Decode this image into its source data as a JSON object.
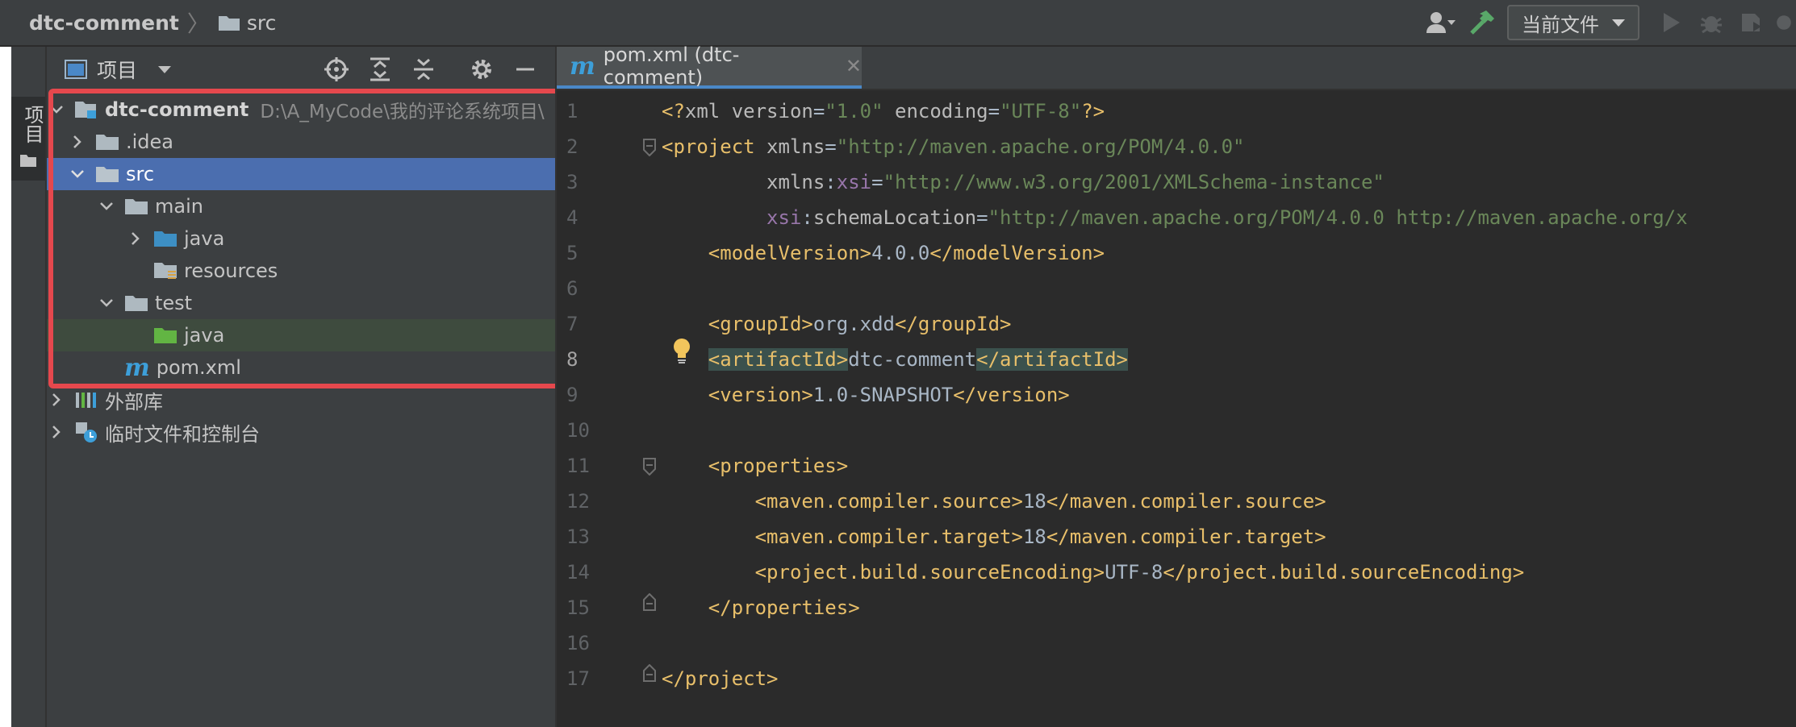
{
  "breadcrumb": {
    "root": "dtc-comment",
    "folder": "src"
  },
  "toolbar": {
    "run_config": "当前文件"
  },
  "tool_strip": {
    "project_tab": "项目"
  },
  "project_panel": {
    "title": "项目",
    "tree": [
      {
        "label": "dtc-comment",
        "path": "D:\\A_MyCode\\我的评论系统项目\\",
        "depth": 0,
        "expanded": true,
        "icon": "module-folder-icon"
      },
      {
        "label": ".idea",
        "depth": 1,
        "expanded": false,
        "icon": "folder-icon"
      },
      {
        "label": "src",
        "depth": 1,
        "expanded": true,
        "icon": "folder-icon",
        "selected": true
      },
      {
        "label": "main",
        "depth": 2,
        "expanded": true,
        "icon": "folder-icon"
      },
      {
        "label": "java",
        "depth": 3,
        "expanded": false,
        "icon": "source-folder-icon"
      },
      {
        "label": "resources",
        "depth": 3,
        "icon": "resources-folder-icon"
      },
      {
        "label": "test",
        "depth": 2,
        "expanded": true,
        "icon": "folder-icon"
      },
      {
        "label": "java",
        "depth": 3,
        "icon": "test-source-folder-icon"
      },
      {
        "label": "pom.xml",
        "depth": 2,
        "icon": "maven-file-icon"
      },
      {
        "label": "外部库",
        "depth": 0,
        "expanded": false,
        "icon": "library-icon"
      },
      {
        "label": "临时文件和控制台",
        "depth": 0,
        "expanded": false,
        "icon": "scratch-icon"
      }
    ]
  },
  "editor": {
    "tab_label": "pom.xml (dtc-comment)",
    "current_line": 8,
    "line_numbers": [
      "1",
      "2",
      "3",
      "4",
      "5",
      "6",
      "7",
      "8",
      "9",
      "10",
      "11",
      "12",
      "13",
      "14",
      "15",
      "16",
      "17"
    ],
    "lines": [
      "<?xml version=\"1.0\" encoding=\"UTF-8\"?>",
      "<project xmlns=\"http://maven.apache.org/POM/4.0.0\"",
      "         xmlns:xsi=\"http://www.w3.org/2001/XMLSchema-instance\"",
      "         xsi:schemaLocation=\"http://maven.apache.org/POM/4.0.0 http://maven.apache.org/x",
      "    <modelVersion>4.0.0</modelVersion>",
      "",
      "    <groupId>org.xdd</groupId>",
      "    <artifactId>dtc-comment</artifactId>",
      "    <version>1.0-SNAPSHOT</version>",
      "",
      "    <properties>",
      "        <maven.compiler.source>18</maven.compiler.source>",
      "        <maven.compiler.target>18</maven.compiler.target>",
      "        <project.build.sourceEncoding>UTF-8</project.build.sourceEncoding>",
      "    </properties>",
      "",
      "</project>"
    ]
  },
  "colors": {
    "selection": "#4b6eaf",
    "highlight_box": "#e5484d",
    "tag": "#e8bf6a",
    "attr_value": "#6a8759",
    "namespace": "#9876aa"
  }
}
